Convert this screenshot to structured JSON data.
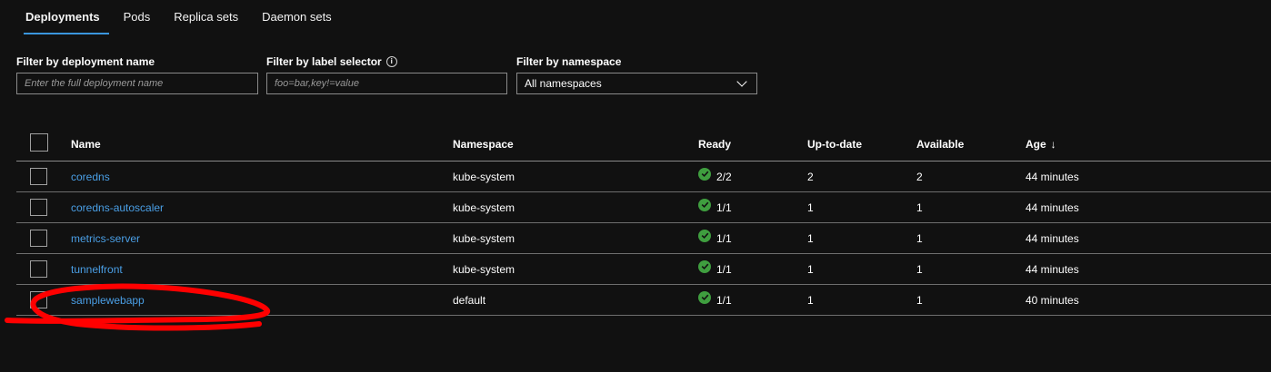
{
  "tabs": [
    {
      "label": "Deployments",
      "active": true
    },
    {
      "label": "Pods",
      "active": false
    },
    {
      "label": "Replica sets",
      "active": false
    },
    {
      "label": "Daemon sets",
      "active": false
    }
  ],
  "filters": {
    "deployment_name": {
      "label": "Filter by deployment name",
      "placeholder": "Enter the full deployment name",
      "value": ""
    },
    "label_selector": {
      "label": "Filter by label selector",
      "placeholder": "foo=bar,key!=value",
      "value": ""
    },
    "namespace": {
      "label": "Filter by namespace",
      "selected": "All namespaces"
    }
  },
  "table": {
    "headers": {
      "name": "Name",
      "namespace": "Namespace",
      "ready": "Ready",
      "up_to_date": "Up-to-date",
      "available": "Available",
      "age": "Age",
      "age_sort": "↓"
    },
    "rows": [
      {
        "name": "coredns",
        "namespace": "kube-system",
        "ready": "2/2",
        "up_to_date": "2",
        "available": "2",
        "age": "44 minutes"
      },
      {
        "name": "coredns-autoscaler",
        "namespace": "kube-system",
        "ready": "1/1",
        "up_to_date": "1",
        "available": "1",
        "age": "44 minutes"
      },
      {
        "name": "metrics-server",
        "namespace": "kube-system",
        "ready": "1/1",
        "up_to_date": "1",
        "available": "1",
        "age": "44 minutes"
      },
      {
        "name": "tunnelfront",
        "namespace": "kube-system",
        "ready": "1/1",
        "up_to_date": "1",
        "available": "1",
        "age": "44 minutes"
      },
      {
        "name": "samplewebapp",
        "namespace": "default",
        "ready": "1/1",
        "up_to_date": "1",
        "available": "1",
        "age": "40 minutes"
      }
    ]
  },
  "icons": {
    "ready_status": "check-circle-icon",
    "info": "info-icon",
    "dropdown": "chevron-down-icon"
  },
  "colors": {
    "background": "#111111",
    "accent": "#3a96dd",
    "link": "#4a9fe6",
    "ready_green": "#3f9e3f",
    "annotation_red": "#ff0000"
  }
}
